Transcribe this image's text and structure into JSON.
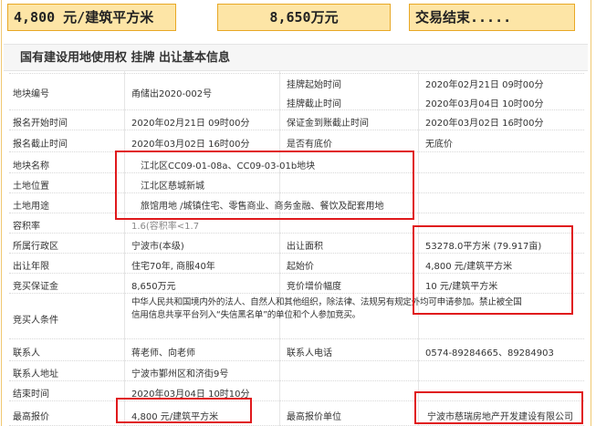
{
  "summary": {
    "price": "4,800 元/建筑平方米",
    "deposit": "8,650万元",
    "status": "交易结束....."
  },
  "section_title": "国有建设用地使用权 挂牌 出让基本信息",
  "rows": {
    "plot_no": {
      "label": "地块编号",
      "value": "甬储出2020-002号"
    },
    "listing_start": {
      "label": "挂牌起始时间",
      "value": "2020年02月21日 09时00分"
    },
    "listing_end": {
      "label": "挂牌截止时间",
      "value": "2020年03月04日 10时00分"
    },
    "reg_start": {
      "label": "报名开始时间",
      "value": "2020年02月21日 09时00分"
    },
    "deposit_deadline": {
      "label": "保证金到账截止时间",
      "value": "2020年03月02日 16时00分"
    },
    "reg_end": {
      "label": "报名截止时间",
      "value": "2020年03月02日 16时00分"
    },
    "reserve": {
      "label": "是否有底价",
      "value": "无底价"
    },
    "plot_name": {
      "label": "地块名称",
      "value": "江北区CC09-01-08a、CC09-03-01b地块"
    },
    "location": {
      "label": "土地位置",
      "value": "江北区慈城新城"
    },
    "usage": {
      "label": "土地用途",
      "value": "旅馆用地 /城镇住宅、零售商业、商务金融、餐饮及配套用地"
    },
    "far": {
      "label": "容积率",
      "value": "1.6(容积率<1.7"
    },
    "district": {
      "label": "所属行政区",
      "value": "宁波市(本级)"
    },
    "area": {
      "label": "出让面积",
      "value": "53278.0平方米 (79.917亩)"
    },
    "term": {
      "label": "出让年限",
      "value": "住宅70年, 商服40年"
    },
    "start_price": {
      "label": "起始价",
      "value": "4,800 元/建筑平方米"
    },
    "bid_deposit": {
      "label": "竞买保证金",
      "value": "8,650万元"
    },
    "increment": {
      "label": "竞价增价幅度",
      "value": "10 元/建筑平方米"
    },
    "conditions": {
      "label": "竞买人条件",
      "lines": [
        "中华人民共和国境内外的法人、自然人和其他组织，除法律、法规另有规定外均可申请参加。禁止被全国",
        "信用信息共享平台列入“失信黑名单”的单位和个人参加竞买。"
      ]
    },
    "contact": {
      "label": "联系人",
      "value": "蒋老师、向老师"
    },
    "phone": {
      "label": "联系人电话",
      "value": "0574-89284665、89284903"
    },
    "address": {
      "label": "联系人地址",
      "value": "宁波市鄞州区和济街9号"
    },
    "end_time": {
      "label": "结束时间",
      "value": "2020年03月04日 10时10分"
    },
    "top_bid": {
      "label": "最高报价",
      "value": "4,800 元/建筑平方米"
    },
    "top_bidder": {
      "label": "最高报价单位",
      "value": "宁波市慈瑞房地产开发建设有限公司"
    }
  },
  "colors": {
    "summary_bg": "#fde5a6",
    "summary_border": "#e8a825",
    "highlight": "#e0191c"
  }
}
